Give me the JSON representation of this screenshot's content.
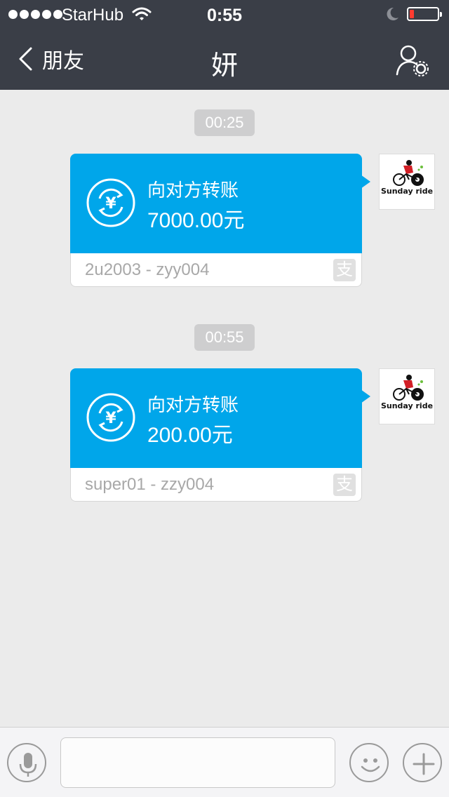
{
  "status_bar": {
    "carrier": "StarHub",
    "time": "0:55"
  },
  "nav": {
    "back_label": "朋友",
    "title": "妍"
  },
  "messages": [
    {
      "timestamp": "00:25",
      "label": "向对方转账",
      "amount": "7000.00元",
      "note": "2u2003 - zyy004",
      "badge": "支",
      "avatar_text": "Sunday ride"
    },
    {
      "timestamp": "00:55",
      "label": "向对方转账",
      "amount": "200.00元",
      "note": "super01 - zzy004",
      "badge": "支",
      "avatar_text": "Sunday ride"
    }
  ],
  "input": {
    "placeholder": ""
  },
  "colors": {
    "header_bg": "#3a3e47",
    "transfer_blue": "#00a6ea",
    "chat_bg": "#ebebeb"
  }
}
